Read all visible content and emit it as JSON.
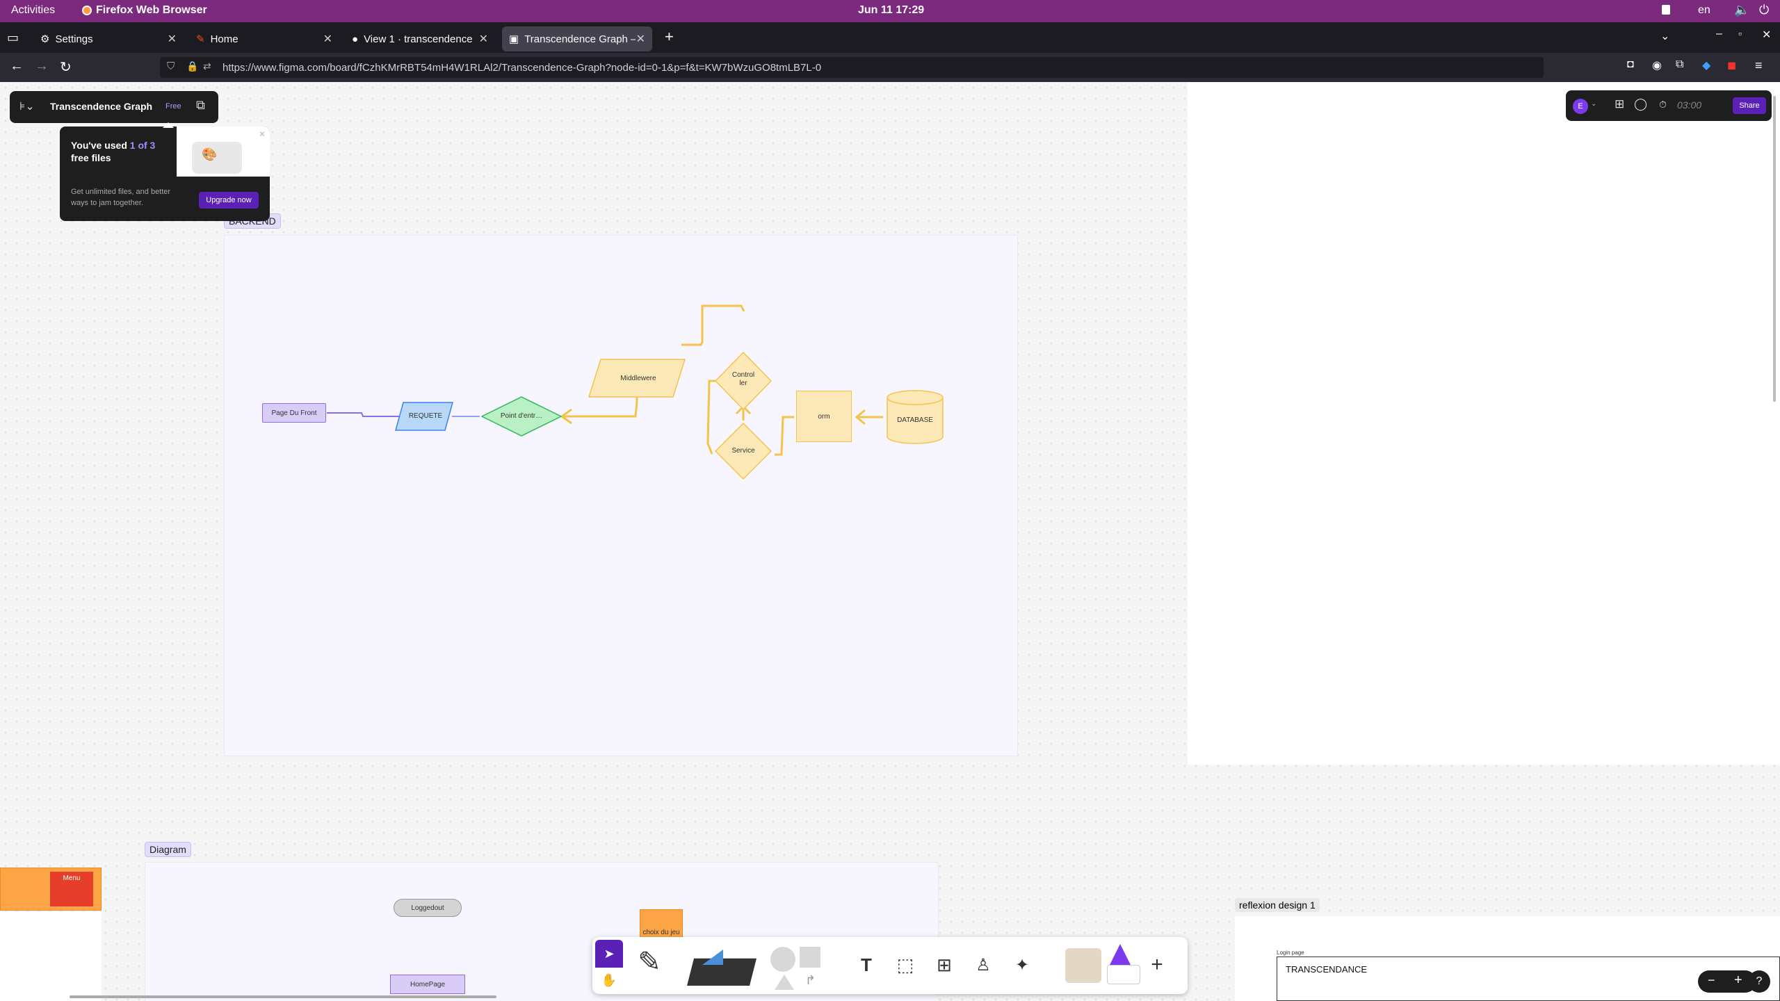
{
  "system": {
    "activities": "Activities",
    "app_name": "Firefox Web Browser",
    "datetime": "Jun 11  17:29",
    "lang": "en"
  },
  "tabs": [
    {
      "label": "Settings"
    },
    {
      "label": "Home"
    },
    {
      "label": "View 1 · transcendence"
    },
    {
      "label": "Transcendence Graph – F"
    }
  ],
  "url": "https://www.figma.com/board/fCzhKMrRBT54mH4W1RLAl2/Transcendence-Graph?node-id=0-1&p=f&t=KW7bWzuGO8tmLB7L-0",
  "figma": {
    "file_title": "Transcendence Graph",
    "plan_badge": "Free",
    "avatar_letter": "E",
    "timer": "03:00",
    "share_label": "Share"
  },
  "popup": {
    "title_pre": "You've used ",
    "title_count": "1 of 3",
    "title_post": "free files",
    "body": "Get unlimited files, and better ways to jam together.",
    "upgrade_label": "Upgrade now"
  },
  "sections": {
    "backend": "BACKEND",
    "diagram": "Diagram",
    "reflexion": "reflexion design 1"
  },
  "backend_nodes": {
    "page_front": "Page Du Front",
    "requete": "REQUETE",
    "point": "Point d'entr…",
    "middleware": "Middlewere",
    "controller_1": "Control",
    "controller_2": "ler",
    "service": "Service",
    "orm": "orm",
    "database": "DATABASE"
  },
  "diagram_nodes": {
    "menu": "Menu",
    "loggedout": "Loggedout",
    "homepage": "HomePage",
    "choix": "choix du jeu"
  },
  "reflexion": {
    "frame_label": "Login page",
    "title": "TRANSCENDANCE"
  },
  "colors": {
    "accent": "#6d28d9",
    "backend_yellow": "#fde9b8",
    "gnome_purple": "#7b2a7e"
  }
}
